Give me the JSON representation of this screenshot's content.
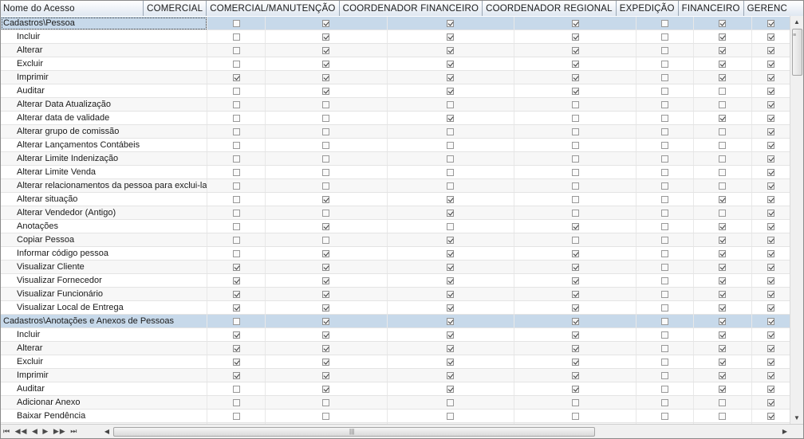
{
  "columns": [
    "Nome do Acesso",
    "COMERCIAL",
    "COMERCIAL/MANUTENÇÃO",
    "COORDENADOR FINANCEIRO",
    "COORDENADOR REGIONAL",
    "EXPEDIÇÃO",
    "FINANCEIRO",
    "GERENC"
  ],
  "rows": [
    {
      "label": "Cadastros\\Pessoa",
      "group": true,
      "checks": [
        0,
        1,
        1,
        1,
        0,
        1,
        1
      ]
    },
    {
      "label": "Incluir",
      "checks": [
        0,
        1,
        1,
        1,
        0,
        1,
        1
      ]
    },
    {
      "label": "Alterar",
      "checks": [
        0,
        1,
        1,
        1,
        0,
        1,
        1
      ]
    },
    {
      "label": "Excluir",
      "checks": [
        0,
        1,
        1,
        1,
        0,
        1,
        1
      ]
    },
    {
      "label": "Imprimir",
      "checks": [
        1,
        1,
        1,
        1,
        0,
        1,
        1
      ]
    },
    {
      "label": "Auditar",
      "checks": [
        0,
        1,
        1,
        1,
        0,
        0,
        1
      ]
    },
    {
      "label": "Alterar Data Atualização",
      "checks": [
        0,
        0,
        0,
        0,
        0,
        0,
        1
      ]
    },
    {
      "label": "Alterar data de validade",
      "checks": [
        0,
        0,
        1,
        0,
        0,
        1,
        1
      ]
    },
    {
      "label": "Alterar grupo de comissão",
      "checks": [
        0,
        0,
        0,
        0,
        0,
        0,
        1
      ]
    },
    {
      "label": "Alterar Lançamentos Contábeis",
      "checks": [
        0,
        0,
        0,
        0,
        0,
        0,
        1
      ]
    },
    {
      "label": "Alterar Limite Indenização",
      "checks": [
        0,
        0,
        0,
        0,
        0,
        0,
        1
      ]
    },
    {
      "label": "Alterar Limite Venda",
      "checks": [
        0,
        0,
        0,
        0,
        0,
        0,
        1
      ]
    },
    {
      "label": "Alterar relacionamentos da pessoa para exclui-la",
      "checks": [
        0,
        0,
        0,
        0,
        0,
        0,
        1
      ]
    },
    {
      "label": "Alterar situação",
      "checks": [
        0,
        1,
        1,
        0,
        0,
        1,
        1
      ]
    },
    {
      "label": "Alterar Vendedor (Antigo)",
      "checks": [
        0,
        0,
        1,
        0,
        0,
        0,
        1
      ]
    },
    {
      "label": "Anotações",
      "checks": [
        0,
        1,
        0,
        1,
        0,
        1,
        1
      ]
    },
    {
      "label": "Copiar Pessoa",
      "checks": [
        0,
        0,
        1,
        0,
        0,
        1,
        1
      ]
    },
    {
      "label": "Informar código pessoa",
      "checks": [
        0,
        1,
        1,
        1,
        0,
        1,
        1
      ]
    },
    {
      "label": "Visualizar Cliente",
      "checks": [
        1,
        1,
        1,
        1,
        0,
        1,
        1
      ]
    },
    {
      "label": "Visualizar Fornecedor",
      "checks": [
        1,
        1,
        1,
        1,
        0,
        1,
        1
      ]
    },
    {
      "label": "Visualizar Funcionário",
      "checks": [
        1,
        1,
        1,
        1,
        0,
        1,
        1
      ]
    },
    {
      "label": "Visualizar Local de Entrega",
      "checks": [
        1,
        1,
        1,
        1,
        0,
        1,
        1
      ]
    },
    {
      "label": "Cadastros\\Anotações e Anexos de Pessoas",
      "group": true,
      "checks": [
        0,
        1,
        1,
        1,
        0,
        1,
        1
      ]
    },
    {
      "label": "Incluir",
      "checks": [
        1,
        1,
        1,
        1,
        0,
        1,
        1
      ]
    },
    {
      "label": "Alterar",
      "checks": [
        1,
        1,
        1,
        1,
        0,
        1,
        1
      ]
    },
    {
      "label": "Excluir",
      "checks": [
        1,
        1,
        1,
        1,
        0,
        1,
        1
      ]
    },
    {
      "label": "Imprimir",
      "checks": [
        1,
        1,
        1,
        1,
        0,
        1,
        1
      ]
    },
    {
      "label": "Auditar",
      "checks": [
        0,
        1,
        1,
        1,
        0,
        1,
        1
      ]
    },
    {
      "label": "Adicionar Anexo",
      "checks": [
        0,
        0,
        0,
        0,
        0,
        0,
        1
      ]
    },
    {
      "label": "Baixar Pendência",
      "checks": [
        0,
        0,
        0,
        0,
        0,
        0,
        1
      ]
    },
    {
      "label": "",
      "checks": [
        0,
        0,
        0,
        0,
        0,
        0,
        0
      ]
    }
  ],
  "navigator": {
    "first": "⏮",
    "prev_page": "◀◀",
    "prev": "◀",
    "next": "▶",
    "next_page": "▶▶",
    "last": "⏭"
  },
  "colors": {
    "group_bg": "#c7d9ea",
    "header_border": "#7b8fa6"
  }
}
